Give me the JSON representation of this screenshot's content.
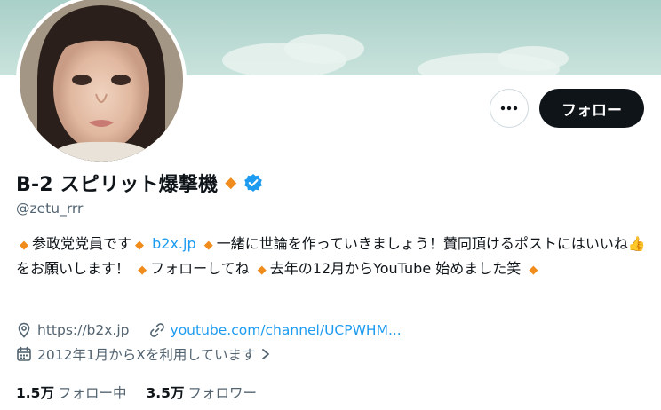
{
  "colors": {
    "accent": "#1d9bf0",
    "diamond": "#f08c1c",
    "text": "#0f1419",
    "secondary": "#536471",
    "button_bg": "#0f1419"
  },
  "profile": {
    "name": "B-2 スピリット爆撃機",
    "handle": "@zetu_rrr",
    "verified_icon": "verified-badge-icon",
    "avatar_icon": "profile-avatar"
  },
  "actions": {
    "more_label": "•••",
    "follow_label": "フォロー"
  },
  "bio": {
    "part1": "参政党党員です",
    "link": "b2x.jp",
    "part2": "一緒に世論を作っていきましょう！賛同頂けるポストにはいいね👍をお願いします！",
    "part3": "フォローしてね",
    "part4": "去年の12月からYouTube 始めました笑"
  },
  "meta": {
    "location": "https://b2x.jp",
    "url": "youtube.com/channel/UCPWHM...",
    "joined": "2012年1月からXを利用しています"
  },
  "stats": {
    "following_count": "1.5万",
    "following_label": "フォロー中",
    "followers_count": "3.5万",
    "followers_label": "フォロワー"
  }
}
